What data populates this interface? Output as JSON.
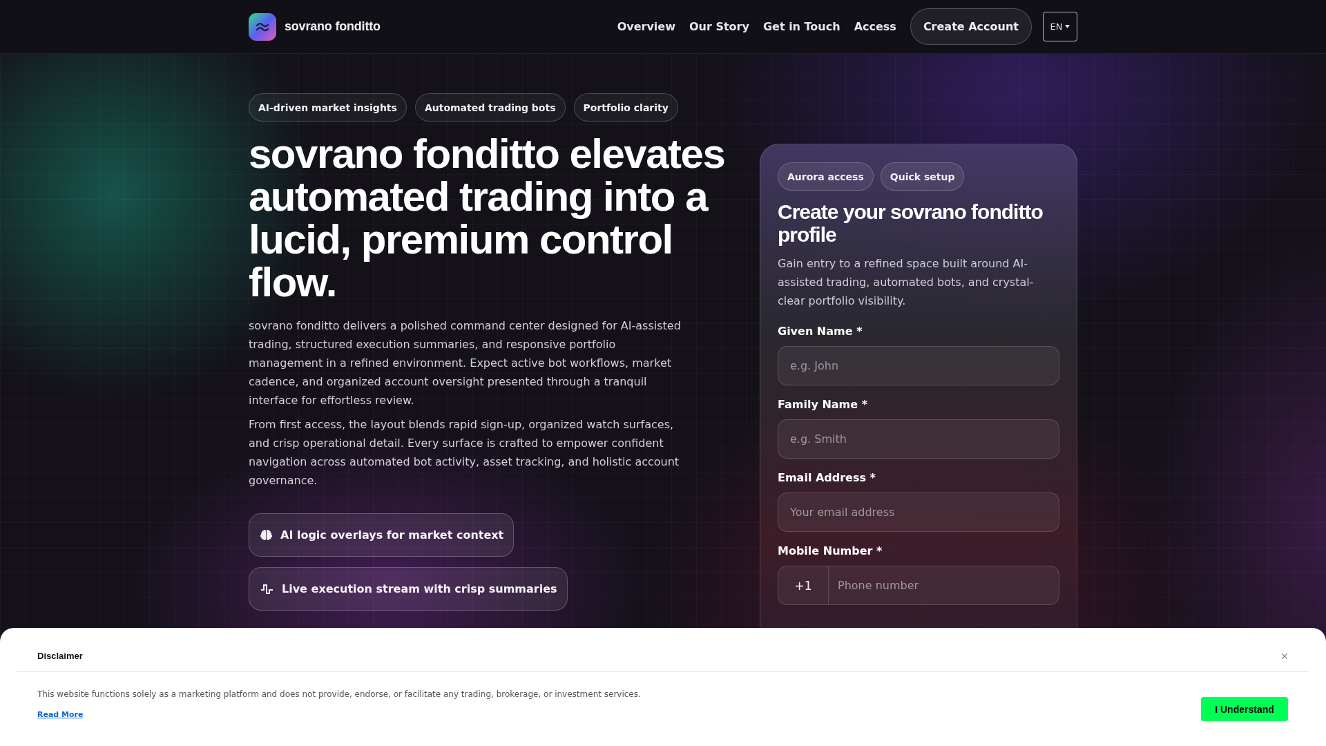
{
  "header": {
    "brand": "sovrano fonditto",
    "nav": [
      {
        "label": "Overview"
      },
      {
        "label": "Our Story"
      },
      {
        "label": "Get in Touch"
      },
      {
        "label": "Access"
      }
    ],
    "cta": "Create Account",
    "language": "EN"
  },
  "hero": {
    "tags": [
      "AI-driven market insights",
      "Automated trading bots",
      "Portfolio clarity"
    ],
    "headline": "sovrano fonditto elevates automated trading into a lucid, premium control flow.",
    "paragraphs": [
      "sovrano fonditto delivers a polished command center designed for AI-assisted trading, structured execution summaries, and responsive portfolio management in a refined environment. Expect active bot workflows, market cadence, and organized account oversight presented through a tranquil interface for effortless review.",
      "From first access, the layout blends rapid sign-up, organized watch surfaces, and crisp operational detail. Every surface is crafted to empower confident navigation across automated bot activity, asset tracking, and holistic account governance."
    ],
    "features": [
      {
        "label": "AI logic overlays for market context"
      },
      {
        "label": "Live execution stream with crisp summaries"
      }
    ]
  },
  "signup": {
    "tags": [
      "Aurora access",
      "Quick setup"
    ],
    "title": "Create your sovrano fonditto profile",
    "description": "Gain entry to a refined space built around AI-assisted trading, automated bots, and crystal-clear portfolio visibility.",
    "fields": [
      {
        "kind": "text",
        "label": "Given Name *",
        "placeholder": "e.g. John"
      },
      {
        "kind": "text",
        "label": "Family Name *",
        "placeholder": "e.g. Smith"
      },
      {
        "kind": "text",
        "label": "Email Address *",
        "placeholder": "Your email address"
      },
      {
        "kind": "phone",
        "label": "Mobile Number *",
        "prefix": "+1",
        "placeholder": "Phone number"
      }
    ]
  },
  "disclaimer": {
    "title": "Disclaimer",
    "text": "This website functions solely as a marketing platform and does not provide, endorse, or facilitate any trading, brokerage, or investment services.",
    "link": "Read More",
    "button": "I Understand"
  }
}
